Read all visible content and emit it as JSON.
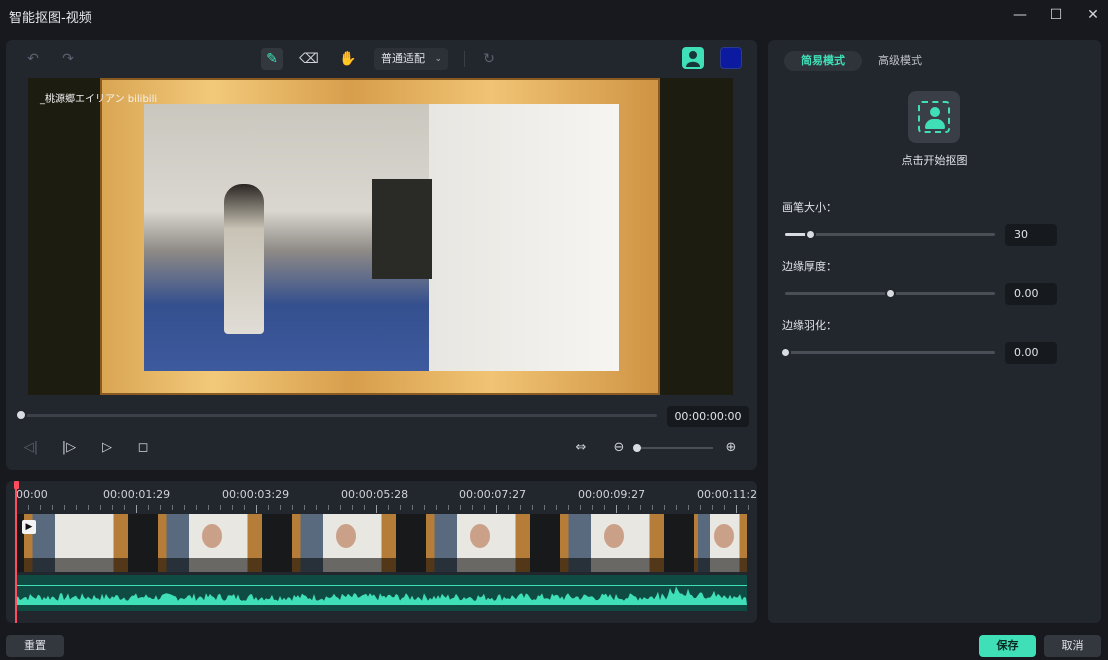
{
  "window": {
    "title": "智能抠图-视频",
    "minimize_icon": "minimize-icon",
    "maximize_icon": "maximize-icon",
    "close_icon": "close-icon"
  },
  "toolbar": {
    "undo_icon": "undo-icon",
    "redo_icon": "redo-icon",
    "brush_icon": "smart-brush-icon",
    "eraser_icon": "eraser-icon",
    "hand_icon": "hand-icon",
    "fit_mode": "普通适配",
    "refresh_icon": "refresh-icon",
    "person_icon": "person-icon",
    "mask_color": "#0b1a9e"
  },
  "preview": {
    "watermark": "_桃源郷エイリアン bilibili"
  },
  "playback": {
    "timecode": "00:00:00:00",
    "progress": 0
  },
  "timeline": {
    "ruler": [
      "00:00",
      "00:00:01:29",
      "00:00:03:29",
      "00:00:05:28",
      "00:00:07:27",
      "00:00:09:27",
      "00:00:11:2"
    ],
    "playhead_color": "#ff4d5e",
    "audio_color": "#3fe0b8"
  },
  "right_panel": {
    "tabs": [
      "简易模式",
      "高级模式"
    ],
    "active_tab": "简易模式",
    "start_label": "点击开始抠图",
    "params": [
      {
        "label": "画笔大小：",
        "value": "30",
        "fraction": 0.12
      },
      {
        "label": "边缘厚度：",
        "value": "0.00",
        "fraction": 0.5
      },
      {
        "label": "边缘羽化：",
        "value": "0.00",
        "fraction": 0.0
      }
    ]
  },
  "footer": {
    "reset": "重置",
    "save": "保存",
    "cancel": "取消"
  },
  "accent": "#3fe0b8"
}
